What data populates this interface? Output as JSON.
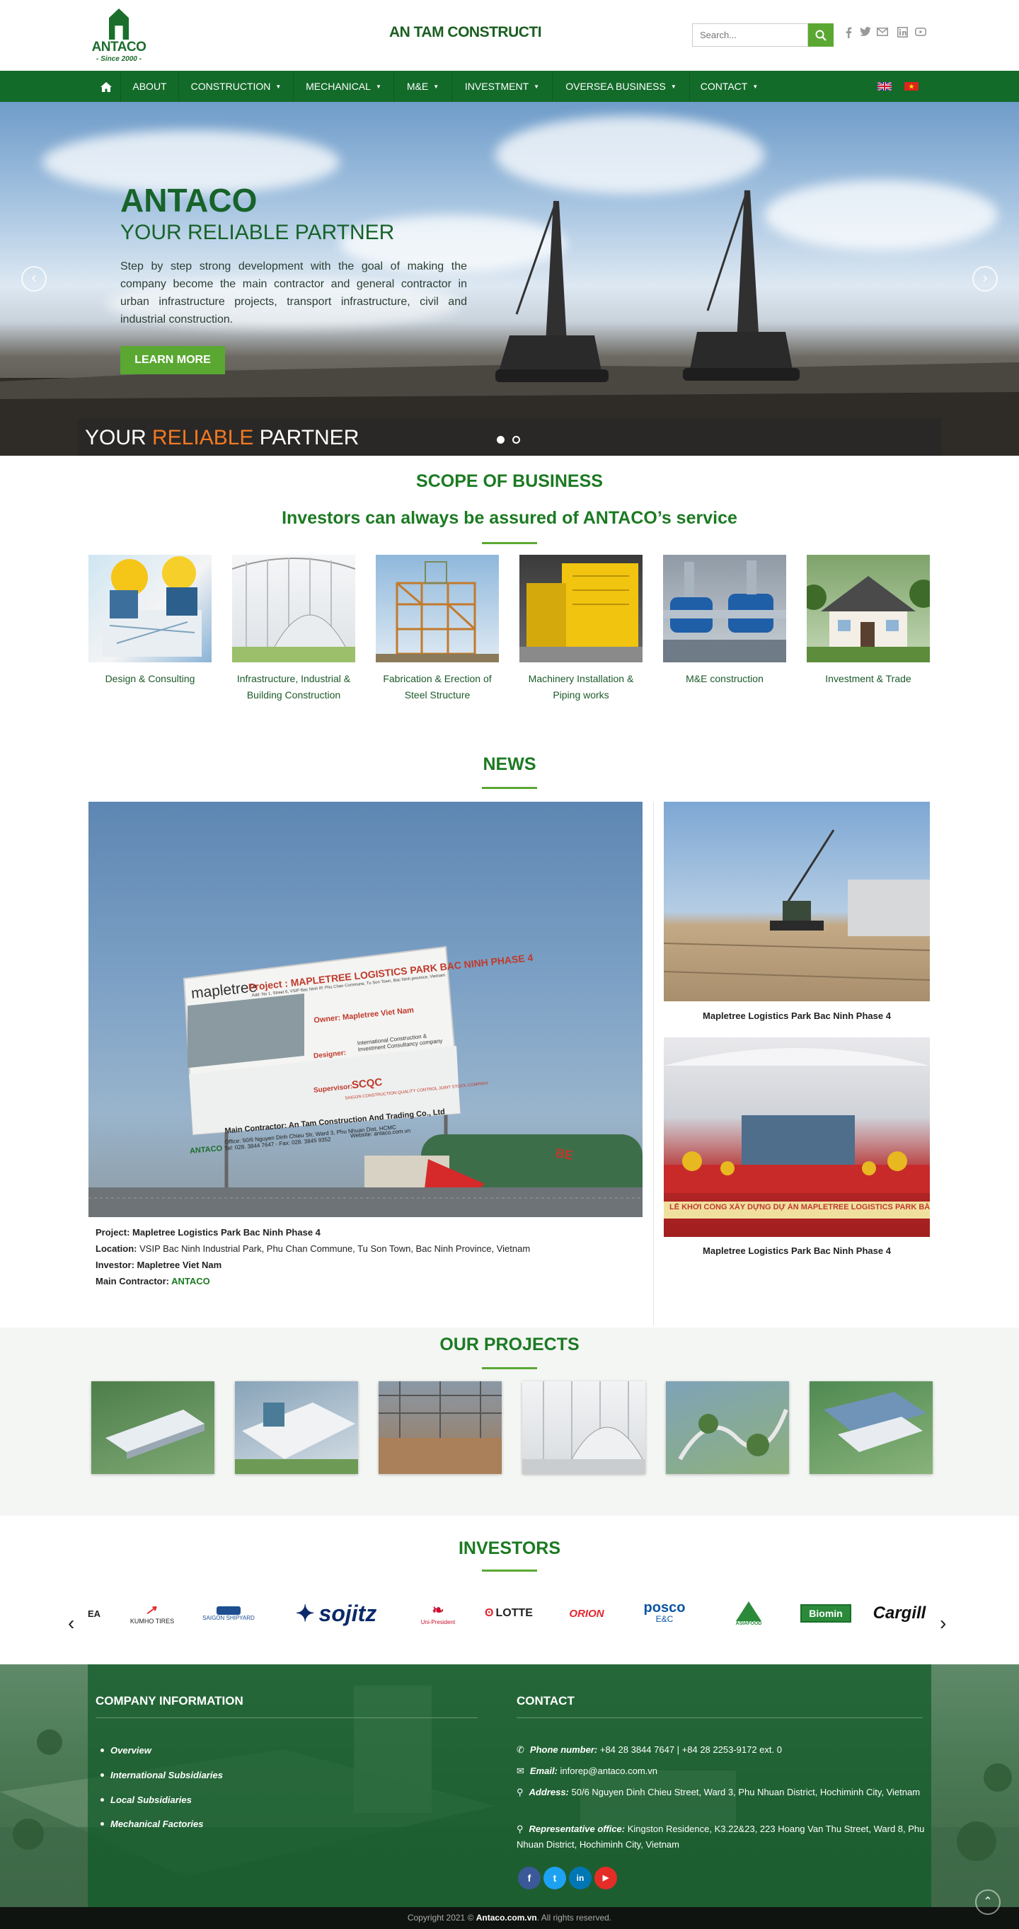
{
  "header": {
    "logo_name": "ANTACO",
    "logo_since": "- Since 2000 -",
    "company_marquee": "AN TAM CONSTRUCTI",
    "search_placeholder": "Search...",
    "social_icons": [
      "facebook-icon",
      "twitter-icon",
      "email-icon",
      "linkedin-icon",
      "youtube-icon"
    ],
    "accent_color": "#136b2a",
    "button_color": "#5aa832"
  },
  "nav": {
    "home_icon": "home-icon",
    "items": [
      {
        "label": "ABOUT",
        "dropdown": false
      },
      {
        "label": "CONSTRUCTION",
        "dropdown": true
      },
      {
        "label": "MECHANICAL",
        "dropdown": true
      },
      {
        "label": "M&E",
        "dropdown": true
      },
      {
        "label": "INVESTMENT",
        "dropdown": true
      },
      {
        "label": "OVERSEA BUSINESS",
        "dropdown": true
      },
      {
        "label": "CONTACT",
        "dropdown": true
      }
    ],
    "flags": [
      "uk-flag-icon",
      "vietnam-flag-icon"
    ]
  },
  "hero": {
    "title": "ANTACO",
    "subtitle": "YOUR RELIABLE PARTNER",
    "description": "Step by step strong development with the goal of making the company become the main contractor and general contractor in urban infrastructure projects, transport infrastructure, civil and industrial construction.",
    "button": "LEARN MORE",
    "strip_a": "YOUR ",
    "strip_b": "RELIABLE",
    "strip_c": " PARTNER",
    "active_slide": 1,
    "slide_count": 2
  },
  "scope": {
    "title": "SCOPE OF BUSINESS",
    "subtitle": "Investors can always be assured of ANTACO’s service",
    "items": [
      {
        "label": "Design & Consulting"
      },
      {
        "label": "Infrastructure, Industrial & Building Construction"
      },
      {
        "label": "Fabrication & Erection of Steel Structure"
      },
      {
        "label": "Machinery Installation & Piping works"
      },
      {
        "label": "M&E construction"
      },
      {
        "label": "Investment & Trade"
      }
    ]
  },
  "news": {
    "title": "NEWS",
    "billboard": {
      "brand": "mapletree",
      "project": "Project : MAPLETREE LOGISTICS PARK BAC NINH PHASE 4",
      "address": "Add: No 1, Street 6, VSIP Bac Ninh IP, Phu Chan Commune, Tu Son Town, Bac Ninh province, Vietnam",
      "owner": "Owner: Mapletree Viet Nam",
      "designer": "Designer:",
      "designer_name": "International Construction & Investment Consultancy company",
      "supervisor": "Supervisor:",
      "supervisor_name": "SCQC",
      "supervisor_full": "SAIGON CONSTRUCTION QUALITY CONTROL JOINT STOCK COMPANY",
      "contractor": "Main Contractor: An Tam Construction And Trading Co., Ltd",
      "office": "Office: 50/6 Nguyen Dinh Chieu Str, Ward 3, Phu Nhuan Dist, HCMC",
      "phone": "Tel: 028. 3844 7647 - Fax: 028. 3845 9352",
      "website": "Website: antaco.com.vn",
      "logo": "ANTACO",
      "truck_text": "BE"
    },
    "main": {
      "project_label": "Project: ",
      "project_value": "Mapletree Logistics Park Bac Ninh Phase 4",
      "location_label": "Location: ",
      "location_value": "VSIP Bac Ninh Industrial Park, Phu Chan Commune, Tu Son Town, Bac Ninh Province, Vietnam",
      "investor_label": "Investor",
      "investor_value": ": Mapletree Viet Nam",
      "contractor_label": "Main Contractor: ",
      "contractor_value": "ANTACO"
    },
    "side": [
      {
        "caption": "Mapletree Logistics Park Bac Ninh Phase 4"
      },
      {
        "caption": "Mapletree Logistics Park Bac Ninh Phase 4",
        "banner": "LỄ KHỞI CÔNG XÂY DỰNG DỰ ÁN MAPLETREE LOGISTICS PARK BẮC NINH PHASE 4"
      }
    ]
  },
  "projects": {
    "title": "OUR PROJECTS",
    "count": 6
  },
  "investors": {
    "title": "INVESTORS",
    "logos": [
      {
        "name": "EA",
        "color": "#222"
      },
      {
        "name": "KUMHO TIRES",
        "color": "#222"
      },
      {
        "name": "SAIGON SHIPYARD",
        "color": "#1d4f91"
      },
      {
        "name": "sojitz",
        "color": "#0b2a6b"
      },
      {
        "name": "Uni-President",
        "color": "#c8102e"
      },
      {
        "name": "LOTTE",
        "color": "#111"
      },
      {
        "name": "ORION",
        "color": "#e3262d"
      },
      {
        "name": "posco",
        "color": "#0d55a3"
      },
      {
        "name": "E&C",
        "color": "#0d55a3"
      },
      {
        "name": "ASIAFOOD",
        "color": "#2a8a3a"
      },
      {
        "name": "Biomin",
        "color": "#ffffff"
      },
      {
        "name": "Cargill",
        "color": "#111"
      }
    ]
  },
  "footer": {
    "company_title": "COMPANY INFORMATION",
    "company_links": [
      "Overview",
      "International Subsidiaries",
      "Local Subsidiaries",
      "Mechanical Factories"
    ],
    "contact_title": "CONTACT",
    "phone_label": "Phone number:",
    "phone_value": " +84 28 3844 7647 | +84 28 2253-9172 ext. 0",
    "email_label": "Email:",
    "email_value": " inforep@antaco.com.vn",
    "address_label": "Address:",
    "address_value": " 50/6 Nguyen Dinh Chieu Street, Ward 3, Phu Nhuan District, Hochiminh City, Vietnam",
    "rep_label": "Representative office:",
    "rep_value": " Kingston Residence, K3.22&23, 223 Hoang Van Thu Street, Ward 8, Phu Nhuan District, Hochiminh City, Vietnam",
    "social": [
      {
        "name": "facebook-icon",
        "glyph": "f",
        "color": "#3b5998"
      },
      {
        "name": "twitter-icon",
        "glyph": "t",
        "color": "#1da1f2"
      },
      {
        "name": "linkedin-icon",
        "glyph": "in",
        "color": "#0077b5"
      },
      {
        "name": "youtube-icon",
        "glyph": "▶",
        "color": "#e52d27"
      }
    ],
    "copyright_a": "Copyright 2021 © ",
    "copyright_b": "Antaco.com.vn",
    "copyright_c": ". All rights reserved."
  }
}
